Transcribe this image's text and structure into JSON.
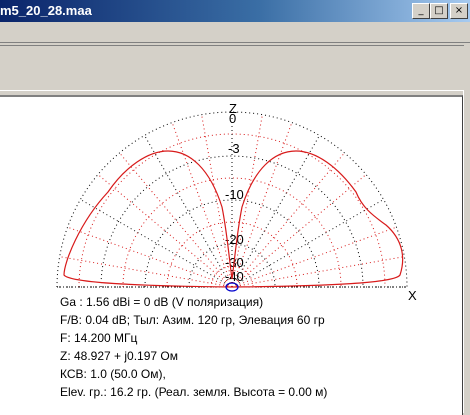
{
  "window": {
    "title": "m5_20_28.maa",
    "buttons": [
      "_",
      "□",
      "×"
    ]
  },
  "plot": {
    "axis_z": "Z",
    "axis_x": "X",
    "ring_labels": [
      "0",
      "-3",
      "-10",
      "-20",
      "-30",
      "-40"
    ],
    "trace_color": "#d81a1a"
  },
  "info": {
    "line1": "Ga : 1.56 dBi = 0 dB  (V поляризация)",
    "line2": "F/B: 0.04 dB; Тыл: Азим. 120 гр, Элевация 60 гр",
    "line3": "F:  14.200 МГц",
    "line4": "Z: 48.927 + j0.197 Ом",
    "line5": "КСВ: 1.0 (50.0 Ом),",
    "line6": "Elev. гр.: 16.2 гр. (Реал. земля. Высота = 0.00 м)"
  }
}
